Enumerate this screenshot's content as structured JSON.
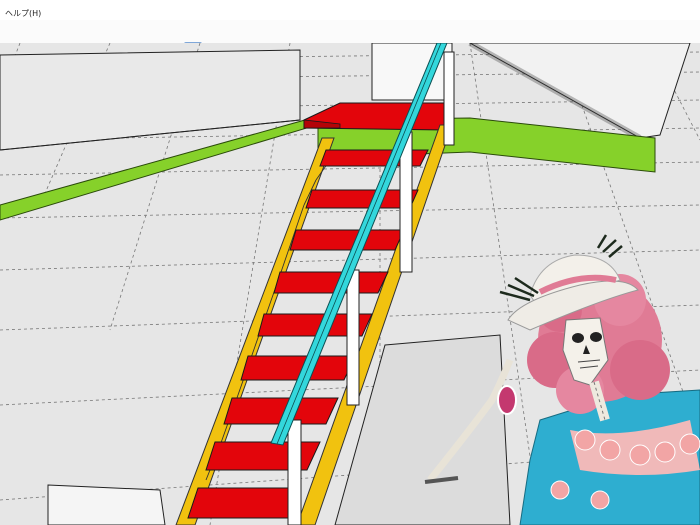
{
  "menubar": {
    "help_label": "ヘルプ(H)"
  },
  "toolbar": {
    "buttons": [
      {
        "name": "dropdown-arrow-icon"
      },
      {
        "name": "push-pull-icon"
      },
      {
        "name": "follow-me-icon"
      },
      {
        "name": "move-icon"
      },
      {
        "name": "rotate-icon"
      },
      {
        "name": "scale-icon"
      },
      {
        "name": "tape-measure-icon"
      },
      {
        "name": "text-icon"
      },
      {
        "name": "paint-bucket-icon"
      },
      {
        "name": "orbit-icon"
      },
      {
        "name": "pan-icon",
        "active": true
      },
      {
        "name": "zoom-icon"
      },
      {
        "name": "zoom-extents-icon"
      },
      {
        "name": "components-icon"
      },
      {
        "name": "warehouse-icon"
      },
      {
        "name": "share-model-icon"
      },
      {
        "name": "extension-icon"
      }
    ]
  },
  "colors": {
    "tread": "#e3050b",
    "stringer": "#f1c20f",
    "handrail": "#33d7dc",
    "beam": "#86d12a",
    "post": "#ffffff",
    "floor": "#e6e6e6",
    "edge": "#1a1a1a"
  }
}
